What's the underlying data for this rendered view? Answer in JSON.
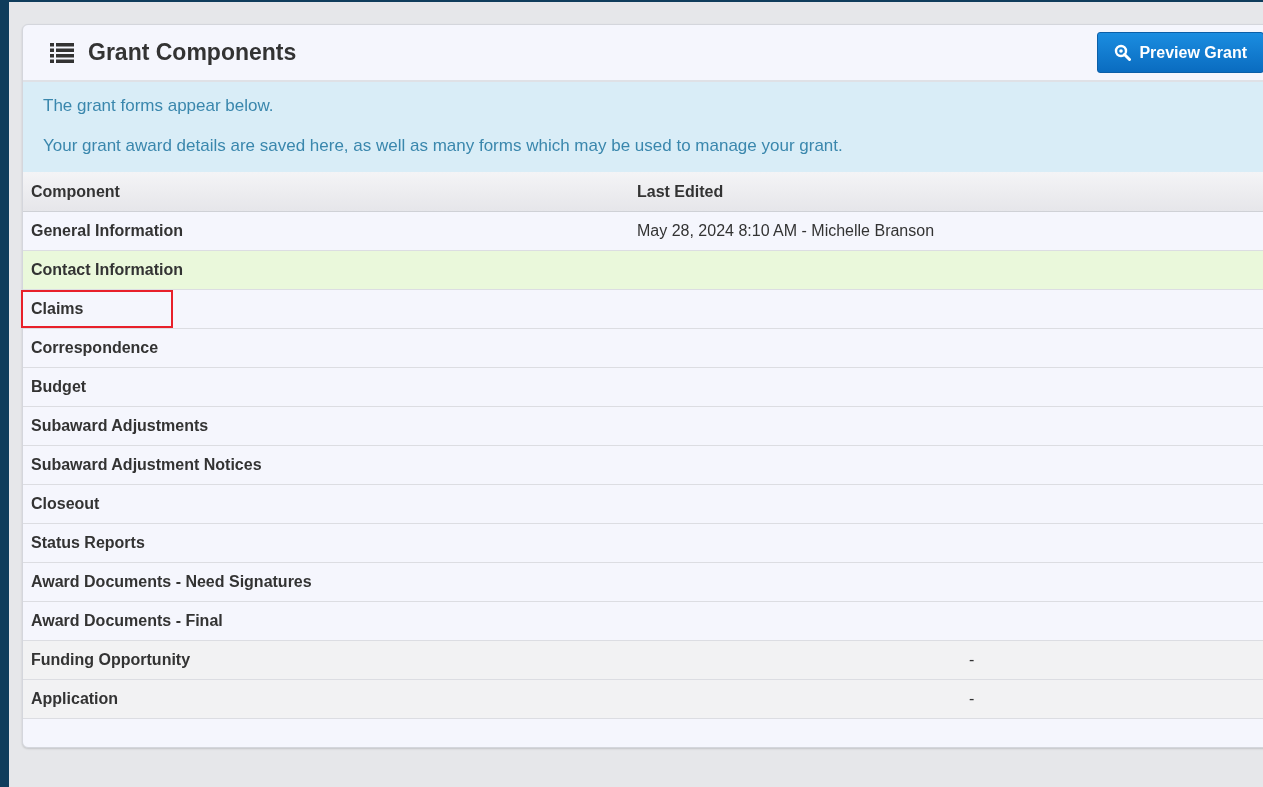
{
  "panel": {
    "title": "Grant Components",
    "preview_button": "Preview Grant"
  },
  "notice": [
    "The grant forms appear below.",
    "Your grant award details are saved here, as well as many forms which may be used to manage your grant."
  ],
  "table": {
    "columns": [
      "Component",
      "Last Edited"
    ],
    "rows": [
      {
        "kind": "form",
        "component": "General Information",
        "last_edited": "May 28, 2024 8:10 AM - Michelle Branson",
        "selected": false,
        "outlined": false
      },
      {
        "kind": "form",
        "component": "Contact Information",
        "selected": true,
        "outlined": false
      },
      {
        "kind": "form",
        "component": "Claims",
        "selected": false,
        "outlined": true
      },
      {
        "kind": "form",
        "component": "Correspondence",
        "selected": false,
        "outlined": false
      },
      {
        "kind": "form",
        "component": "Budget",
        "selected": false,
        "outlined": false
      },
      {
        "kind": "form",
        "component": "Subaward Adjustments",
        "selected": false,
        "outlined": false
      },
      {
        "kind": "form",
        "component": "Subaward Adjustment Notices",
        "selected": false,
        "outlined": false
      },
      {
        "kind": "form",
        "component": "Closeout",
        "selected": false,
        "outlined": false
      },
      {
        "kind": "form",
        "component": "Status Reports",
        "selected": false,
        "outlined": false
      },
      {
        "kind": "form",
        "component": "Award Documents - Need Signatures",
        "selected": false,
        "outlined": false
      },
      {
        "kind": "form",
        "component": "Award Documents - Final",
        "selected": false,
        "outlined": false
      },
      {
        "kind": "linked",
        "component": "Funding Opportunity",
        "column_3": "-",
        "selected": false,
        "outlined": false
      },
      {
        "kind": "linked",
        "component": "Application",
        "column_3": "-",
        "selected": false,
        "outlined": false
      }
    ]
  }
}
